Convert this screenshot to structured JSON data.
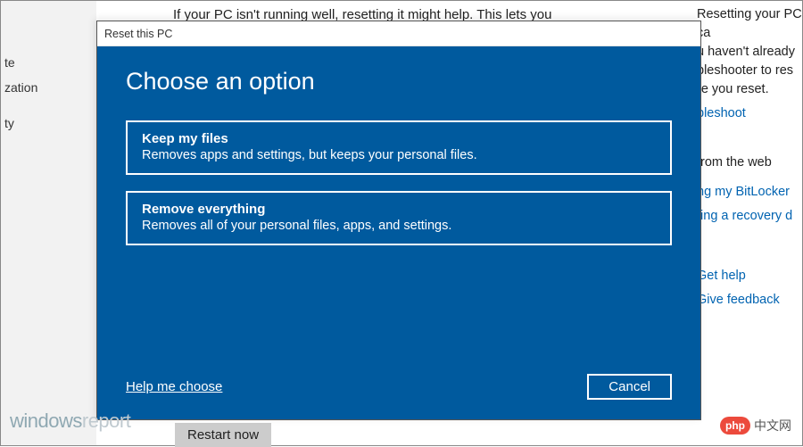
{
  "background": {
    "left_nav": [
      "te",
      "zation",
      "ty"
    ],
    "top_paragraph": "If your PC isn't running well, resetting it might help. This lets you",
    "restart_button": "Restart now",
    "right_panel": {
      "desc_line1": "Resetting your PC ca",
      "desc_line2": "u haven't already",
      "desc_line3": "bleshooter to res",
      "desc_line4": "re you reset.",
      "link_troubleshoot": "bleshoot",
      "text_from_web": "from the web",
      "link_bitlocker": "ng my BitLocker",
      "link_recovery": "ting a recovery d",
      "link_gethelp": "Get help",
      "link_feedback": "Give feedback"
    }
  },
  "dialog": {
    "title": "Reset this PC",
    "heading": "Choose an option",
    "options": [
      {
        "title": "Keep my files",
        "desc": "Removes apps and settings, but keeps your personal files."
      },
      {
        "title": "Remove everything",
        "desc": "Removes all of your personal files, apps, and settings."
      }
    ],
    "help_link": "Help me choose",
    "cancel_label": "Cancel"
  },
  "watermarks": {
    "windowsreport_a": "windows",
    "windowsreport_b": "report",
    "phpcn_badge": "php",
    "phpcn_text": "中文网"
  },
  "colors": {
    "dialog_bg": "#005a9e",
    "link_blue": "#0063b1"
  }
}
